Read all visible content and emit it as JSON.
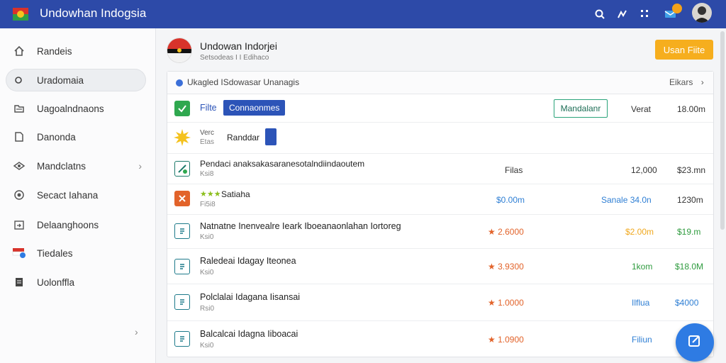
{
  "app": {
    "title": "Undowhan Indogsia"
  },
  "sidebar": {
    "items": [
      {
        "label": "Randeis",
        "icon": "home-icon"
      },
      {
        "label": "Uradomaia",
        "icon": "search-icon"
      },
      {
        "label": "Uagoalndnaons",
        "icon": "folder-icon"
      },
      {
        "label": "Danonda",
        "icon": "document-icon"
      },
      {
        "label": "Mandclatns",
        "icon": "layers-icon"
      },
      {
        "label": "Secact Iahana",
        "icon": "target-icon"
      },
      {
        "label": "Delaanghoons",
        "icon": "import-icon"
      },
      {
        "label": "Tiedales",
        "icon": "flag-badge-icon"
      },
      {
        "label": "Uolonffla",
        "icon": "list-icon"
      }
    ]
  },
  "header": {
    "title": "Undowan Indorjei",
    "subtitle": "Setsodeas I I Edihaco",
    "primary_button": "Usan Fiite"
  },
  "panel": {
    "breadcrumb": "Ukagled ISdowasar Unanagis",
    "filter_label": "Eikars"
  },
  "rows": [
    {
      "file_label": "Filte",
      "tag": "Connaonmes",
      "outline_button": "Mandalanr",
      "col_a": "Verat",
      "col_b": "18.00m"
    },
    {
      "name_top": "Verc",
      "name_bottom": "Etas",
      "field": "Randdar"
    },
    {
      "name": "Pendaci anaksakasaranesotalndiindaoutem",
      "sub": "Ksi8",
      "col_mid": "Filas",
      "col_a": "12,000",
      "col_b": "$23.mn"
    },
    {
      "stars": "★★★",
      "name": "Satiaha",
      "sub": "Fi5i8",
      "col_mid": "$0.00m",
      "col_a": "Sanale 34.0n",
      "col_b": "1230m"
    },
    {
      "name": "Natnatne Inenvealre Ieark Iboeanaonlahan Iortoreg",
      "sub": "Ksi0",
      "col_mid": "★ 2.6000",
      "col_a": "$2.00m",
      "col_b": "$19.m"
    },
    {
      "name": "Raledeai Idagay Iteonea",
      "sub": "Ksi0",
      "col_mid": "★ 3.9300",
      "col_a": "1kom",
      "col_b": "$18.0M"
    },
    {
      "name": "Polclalai Idagana Iisansai",
      "sub": "Rsi0",
      "col_mid": "★ 1.0000",
      "col_a": "Ilflua",
      "col_b": "$4000"
    },
    {
      "name": "Balcalcai Idagna Iiboacai",
      "sub": "Ksi0",
      "col_mid": "★ 1.0900",
      "col_a": "Filiun",
      "col_b": ""
    }
  ],
  "colors": {
    "topbar": "#2d4aa8",
    "accent_orange": "#f6ae1e",
    "orange_value": "#e2632a",
    "green_value": "#2e9b3e",
    "blue_value": "#2f7fd4",
    "fab": "#2e7be3"
  }
}
